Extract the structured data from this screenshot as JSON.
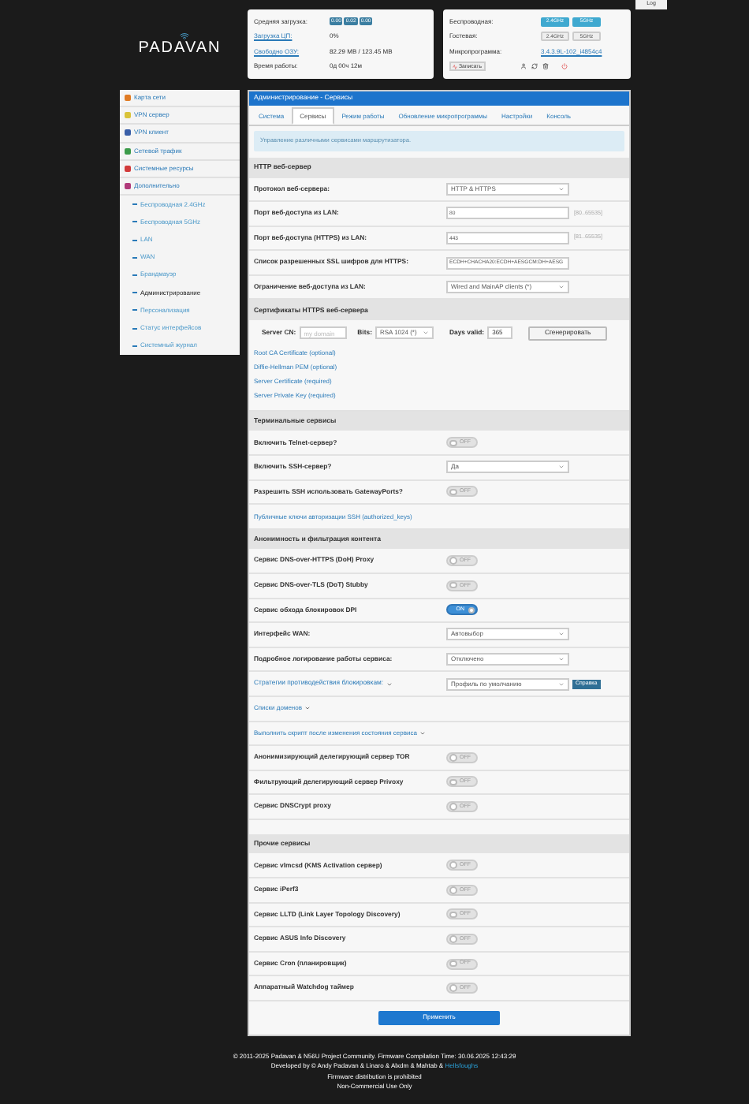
{
  "log_button": "Log",
  "logo": "PADAVAN",
  "status_left": [
    {
      "kind": "badges",
      "label": "Средняя загрузка:",
      "badges": [
        "0.00",
        "0.02",
        "0.00"
      ]
    },
    {
      "kind": "text",
      "label": "Загрузка ЦП:",
      "link": true,
      "value": "0%"
    },
    {
      "kind": "text",
      "label": "Свободно ОЗУ:",
      "link": true,
      "value": "82.29 MB / 123.45 MB"
    },
    {
      "kind": "text",
      "label": "Время работы:",
      "link": false,
      "value": "0д 00ч 12м"
    }
  ],
  "status_right": [
    {
      "kind": "bands",
      "label": "Беспроводная:",
      "bands": [
        {
          "label": "2.4GHz",
          "on": true
        },
        {
          "label": "5GHz",
          "on": true
        }
      ]
    },
    {
      "kind": "bands",
      "label": "Гостевая:",
      "bands": [
        {
          "label": "2.4GHz",
          "on": false
        },
        {
          "label": "5GHz",
          "on": false
        }
      ]
    },
    {
      "kind": "firmware",
      "label": "Микропрограмма:",
      "value": "3.4.3.9L-102_i4854c4"
    },
    {
      "kind": "actions",
      "label": "Записать"
    }
  ],
  "sidebar": [
    {
      "label": "Карта сети",
      "color": "#e07b24",
      "selected": false
    },
    {
      "label": "VPN сервер",
      "color": "#d9c33a",
      "selected": false
    },
    {
      "label": "VPN клиент",
      "color": "#3a5fa8",
      "selected": false
    },
    {
      "label": "Сетевой трафик",
      "color": "#3c9b4a",
      "selected": false
    },
    {
      "label": "Системные ресурсы",
      "color": "#d23b3b",
      "selected": false
    },
    {
      "label": "Дополнительно",
      "color": "#b03a7a",
      "selected": false,
      "children": [
        {
          "label": "Беспроводная 2.4GHz",
          "selected": false
        },
        {
          "label": "Беспроводная 5GHz",
          "selected": false
        },
        {
          "label": "LAN",
          "selected": false
        },
        {
          "label": "WAN",
          "selected": false
        },
        {
          "label": "Брандмауэр",
          "selected": false
        },
        {
          "label": "Администрирование",
          "selected": true
        },
        {
          "label": "Персонализация",
          "selected": false
        },
        {
          "label": "Статус интерфейсов",
          "selected": false
        },
        {
          "label": "Системный журнал",
          "selected": false
        }
      ]
    }
  ],
  "panel_title": "Администрирование - Сервисы",
  "tabs": [
    {
      "label": "Система",
      "selected": false
    },
    {
      "label": "Сервисы",
      "selected": true
    },
    {
      "label": "Режим работы",
      "selected": false
    },
    {
      "label": "Обновление микропрограммы",
      "selected": false
    },
    {
      "label": "Настройки",
      "selected": false
    },
    {
      "label": "Консоль",
      "selected": false
    }
  ],
  "info": "Управление различными сервисами маршрутизатора.",
  "sections": [
    {
      "title": "HTTP веб-сервер",
      "rows": [
        {
          "kind": "select",
          "label": "Протокол веб-сервера:",
          "value": "HTTP & HTTPS"
        },
        {
          "kind": "input",
          "label": "Порт веб-доступа из LAN:",
          "value": "80",
          "hint": "[80..65535]"
        },
        {
          "kind": "input",
          "label": "Порт веб-доступа (HTTPS) из LAN:",
          "value": "443",
          "hint": "[81..65535]"
        },
        {
          "kind": "input",
          "label": "Список разрешенных SSL шифров для HTTPS:",
          "value": "ECDH+CHACHA20:ECDH+AESGCM:DH+AESG"
        },
        {
          "kind": "select",
          "label": "Ограничение веб-доступа из LAN:",
          "value": "Wired and MainAP clients (*)"
        }
      ]
    },
    {
      "title": "Сертификаты HTTPS веб-сервера",
      "rows": [
        {
          "kind": "cert",
          "cn_label": "Server CN:",
          "cn_placeholder": "my domain",
          "bits_label": "Bits:",
          "bits": "RSA 1024 (*)",
          "days_label": "Days valid:",
          "days": "365",
          "button": "Сгенерировать"
        },
        {
          "kind": "links",
          "links": [
            "Root CA Certificate (optional)",
            "Diffie-Hellman PEM (optional)",
            "Server Certificate (required)",
            "Server Private Key (required)"
          ]
        }
      ]
    },
    {
      "title": "Терминальные сервисы",
      "rows": [
        {
          "kind": "toggle",
          "label": "Включить Telnet-сервер?",
          "on": false,
          "text": "OFF"
        },
        {
          "kind": "select",
          "label": "Включить SSH-сервер?",
          "value": "Да"
        },
        {
          "kind": "toggle",
          "label": "Разрешить SSH использовать GatewayPorts?",
          "on": false,
          "text": "OFF"
        },
        {
          "kind": "link",
          "label": "Публичные ключи авторизации SSH (authorized_keys)",
          "caret": false
        }
      ]
    },
    {
      "title": "Анонимность и фильтрация контента",
      "rows": [
        {
          "kind": "toggle",
          "label": "Сервис DNS-over-HTTPS (DoH) Proxy",
          "on": false,
          "text": "OFF"
        },
        {
          "kind": "toggle",
          "label": "Сервис DNS-over-TLS (DoT) Stubby",
          "on": false,
          "text": "OFF"
        },
        {
          "kind": "toggle",
          "label": "Сервис обхода блокировок DPI",
          "on": true,
          "text": "ON"
        },
        {
          "kind": "select",
          "label": "Интерфейс WAN:",
          "value": "Автовыбор"
        },
        {
          "kind": "select",
          "label": "Подробное логирование работы сервиса:",
          "value": "Отключено"
        },
        {
          "kind": "strategy",
          "label": "Стратегии противодействия блокировкам:",
          "value": "Профиль по умолчанию",
          "button": "Справка"
        },
        {
          "kind": "link",
          "label": "Списки доменов",
          "caret": true
        },
        {
          "kind": "link",
          "label": "Выполнить скрипт после изменения состояния сервиса",
          "caret": true
        },
        {
          "kind": "toggle",
          "label": "Анонимизирующий делегирующий сервер TOR",
          "on": false,
          "text": "OFF"
        },
        {
          "kind": "toggle",
          "label": "Фильтрующий делегирующий сервер Privoxy",
          "on": false,
          "text": "OFF"
        },
        {
          "kind": "toggle",
          "label": "Сервис DNSCrypt proxy",
          "on": false,
          "text": "OFF"
        }
      ]
    },
    {
      "title": "Прочие сервисы",
      "rows": [
        {
          "kind": "toggle",
          "label": "Сервис vlmcsd (KMS Activation сервер)",
          "on": false,
          "text": "OFF"
        },
        {
          "kind": "toggle",
          "label": "Сервис iPerf3",
          "on": false,
          "text": "OFF"
        },
        {
          "kind": "toggle",
          "label": "Сервис LLTD (Link Layer Topology Discovery)",
          "on": false,
          "text": "OFF"
        },
        {
          "kind": "toggle",
          "label": "Сервис ASUS Info Discovery",
          "on": false,
          "text": "OFF"
        },
        {
          "kind": "toggle",
          "label": "Сервис Cron (планировщик)",
          "on": false,
          "text": "OFF"
        },
        {
          "kind": "toggle",
          "label": "Аппаратный Watchdog таймер",
          "on": false,
          "text": "OFF"
        }
      ]
    }
  ],
  "apply_button": "Применить",
  "footer": {
    "lines": [
      "© 2011-2025 Padavan & N56U Project Community. Firmware Compilation Time: 30.06.2025 12:43:29",
      "Developed by © Andy Padavan & Linaro & Alxdm & Mahtab & ",
      "Firmware distribution is prohibited",
      "Non-Commercial Use Only"
    ],
    "link": "Hellsfoughs"
  }
}
